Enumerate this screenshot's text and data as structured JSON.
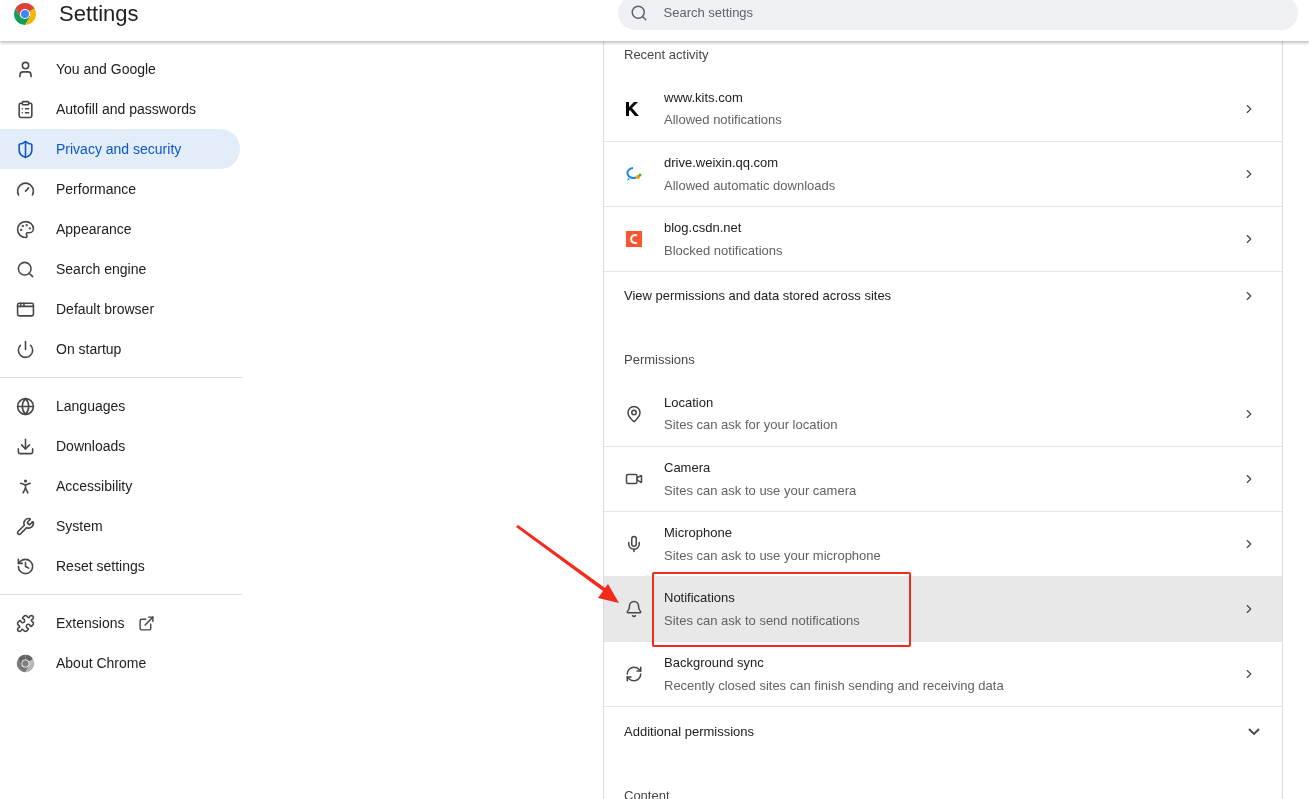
{
  "header": {
    "title": "Settings",
    "search": {
      "placeholder": "Search settings"
    }
  },
  "sidebar": {
    "groups": [
      {
        "items": [
          {
            "label": "You and Google",
            "selected": false
          },
          {
            "label": "Autofill and passwords",
            "selected": false
          },
          {
            "label": "Privacy and security",
            "selected": true
          },
          {
            "label": "Performance",
            "selected": false
          },
          {
            "label": "Appearance",
            "selected": false
          },
          {
            "label": "Search engine",
            "selected": false
          },
          {
            "label": "Default browser",
            "selected": false
          },
          {
            "label": "On startup",
            "selected": false
          }
        ]
      },
      {
        "items": [
          {
            "label": "Languages",
            "selected": false
          },
          {
            "label": "Downloads",
            "selected": false
          },
          {
            "label": "Accessibility",
            "selected": false
          },
          {
            "label": "System",
            "selected": false
          },
          {
            "label": "Reset settings",
            "selected": false
          }
        ]
      },
      {
        "items": [
          {
            "label": "Extensions",
            "selected": false,
            "external": true
          },
          {
            "label": "About Chrome",
            "selected": false,
            "external": false
          }
        ]
      }
    ]
  },
  "sections": [
    {
      "title": "Recent activity",
      "rows": [
        {
          "kind": "site",
          "title": "www.kits.com",
          "subtitle": "Allowed notifications",
          "highlighted": false
        },
        {
          "kind": "site",
          "title": "drive.weixin.qq.com",
          "subtitle": "Allowed automatic downloads",
          "highlighted": false
        },
        {
          "kind": "site",
          "title": "blog.csdn.net",
          "subtitle": "Blocked notifications",
          "highlighted": false
        },
        {
          "kind": "link",
          "title": "View permissions and data stored across sites",
          "highlighted": false
        }
      ]
    },
    {
      "title": "Permissions",
      "rows": [
        {
          "kind": "permission",
          "title": "Location",
          "subtitle": "Sites can ask for your location",
          "highlighted": false
        },
        {
          "kind": "permission",
          "title": "Camera",
          "subtitle": "Sites can ask to use your camera",
          "highlighted": false
        },
        {
          "kind": "permission",
          "title": "Microphone",
          "subtitle": "Sites can ask to use your microphone",
          "highlighted": false
        },
        {
          "kind": "permission",
          "title": "Notifications",
          "subtitle": "Sites can ask to send notifications",
          "highlighted": true
        },
        {
          "kind": "permission",
          "title": "Background sync",
          "subtitle": "Recently closed sites can finish sending and receiving data",
          "highlighted": false
        },
        {
          "kind": "expand",
          "title": "Additional permissions",
          "expanded": false,
          "highlighted": false
        }
      ]
    },
    {
      "title": "Content"
    }
  ]
}
